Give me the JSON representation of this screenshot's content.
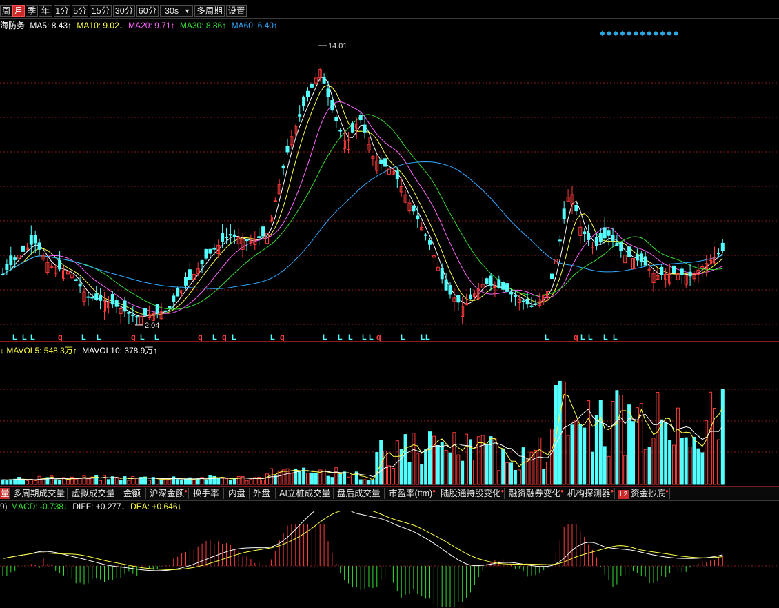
{
  "toolbar": {
    "periods": [
      {
        "label": "周",
        "active": false
      },
      {
        "label": "月",
        "active": true
      },
      {
        "label": "季",
        "active": false
      },
      {
        "label": "年",
        "active": false
      },
      {
        "label": "1分",
        "active": false
      },
      {
        "label": "5分",
        "active": false
      },
      {
        "label": "15分",
        "active": false
      },
      {
        "label": "30分",
        "active": false
      },
      {
        "label": "60分",
        "active": false
      },
      {
        "label": "30s",
        "active": false
      },
      {
        "label": "多周期",
        "active": false
      },
      {
        "label": "设置",
        "active": false
      }
    ]
  },
  "main_legend": {
    "stock": "海防务",
    "ma5": "MA5: 8.43↑",
    "ma10": "MA10: 9.02↓",
    "ma20": "MA20: 9.71↑",
    "ma30": "MA30: 8.86↑",
    "ma60": "MA60: 6.40↑"
  },
  "price_labels": {
    "high": "14.01",
    "low": "2.04"
  },
  "vol_legend": {
    "mavol5": "MAVOL5: 548.3万↑",
    "mavol10": "MAVOL10: 378.9万↑"
  },
  "tabs": [
    {
      "label": "量",
      "dot": false
    },
    {
      "label": "多周期成交量",
      "dot": false
    },
    {
      "label": "虚拟成交量",
      "dot": false
    },
    {
      "label": "金额",
      "dot": false
    },
    {
      "label": "沪深金额",
      "dot": true
    },
    {
      "label": "换手率",
      "dot": false
    },
    {
      "label": "内盘",
      "dot": false
    },
    {
      "label": "外盘",
      "dot": false
    },
    {
      "label": "AI立桩成交量",
      "dot": false
    },
    {
      "label": "盘后成交量",
      "dot": false
    },
    {
      "label": "市盈率(ttm)",
      "dot": true
    },
    {
      "label": "陆股通持股变化",
      "dot": true
    },
    {
      "label": "融资融券变化",
      "dot": true
    },
    {
      "label": "机构探测器",
      "dot": true
    },
    {
      "label": "资金抄底",
      "dot": true,
      "badge": "L2"
    }
  ],
  "macd_legend": {
    "prefix": "9)",
    "macd": "MACD: -0.738↓",
    "diff": "DIFF: +0.277↓",
    "dea": "DEA: +0.646↓"
  },
  "colors": {
    "up": "#ff3b3b",
    "down": "#54ffff",
    "ma5": "#ffffff",
    "ma10": "#ffff44",
    "ma20": "#ff66ff",
    "ma30": "#33dd33",
    "ma60": "#33aaff",
    "grid": "#8c1c1c",
    "active_tab": "#cc2a2a"
  },
  "signal_marks": "L L L q L L q L L q L q L L q L L L L L q L L L L q L L L L L L L"
}
